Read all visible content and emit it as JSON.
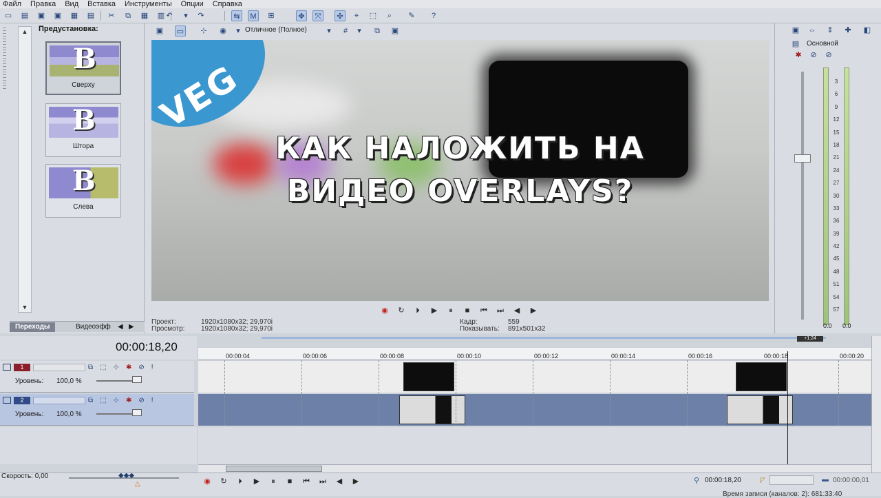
{
  "menu": [
    "Файл",
    "Правка",
    "Вид",
    "Вставка",
    "Инструменты",
    "Опции",
    "Справка"
  ],
  "left_panel": {
    "title": "Предустановка:",
    "presets": [
      {
        "label": "Сверху",
        "glyph": "B"
      },
      {
        "label": "Штора",
        "glyph": "B"
      },
      {
        "label": "Слева",
        "glyph": "B"
      }
    ],
    "tabs": [
      "Переходы",
      "Видеоэфф"
    ]
  },
  "preview": {
    "quality": "Отличное (Полное)",
    "badge": "VEG",
    "title_line1": "КАК НАЛОЖИТЬ НА",
    "title_line2": "ВИДЕО OVERLAYS?",
    "info": {
      "project_label": "Проект:",
      "project_value": "1920x1080x32; 29,970i",
      "preview_label": "Просмотр:",
      "preview_value": "1920x1080x32; 29,970i",
      "frame_label": "Кадр:",
      "frame_value": "559",
      "show_label": "Показывать:",
      "show_value": "891x501x32"
    }
  },
  "mixer": {
    "label": "Основной",
    "db_ticks": [
      "3",
      "6",
      "9",
      "12",
      "15",
      "18",
      "21",
      "24",
      "27",
      "30",
      "33",
      "36",
      "39",
      "42",
      "45",
      "48",
      "51",
      "54",
      "57"
    ],
    "left_value": "0.0",
    "right_value": "0.0"
  },
  "timeline": {
    "timecode": "00:00:18,20",
    "cursor_badge": "+1:24",
    "ruler": [
      "00:00:04",
      "00:00:06",
      "00:00:08",
      "00:00:10",
      "00:00:12",
      "00:00:14",
      "00:00:16",
      "00:00:18",
      "00:00:20"
    ],
    "tracks": [
      {
        "number": "1",
        "level_label": "Уровень:",
        "level_value": "100,0 %"
      },
      {
        "number": "2",
        "level_label": "Уровень:",
        "level_value": "100,0 %"
      }
    ]
  },
  "bottom": {
    "speed": "Скорость: 0,00",
    "time": "00:00:18,20",
    "time_right": "00:00:00,01",
    "status": "Время записи (каналов: 2): 681:33:40"
  },
  "colors": {
    "track1_color": "#8a1f2a",
    "track2_color": "#2f4a86",
    "lane2_bg": "#6d81a8",
    "lane1_bg": "#ededed"
  }
}
